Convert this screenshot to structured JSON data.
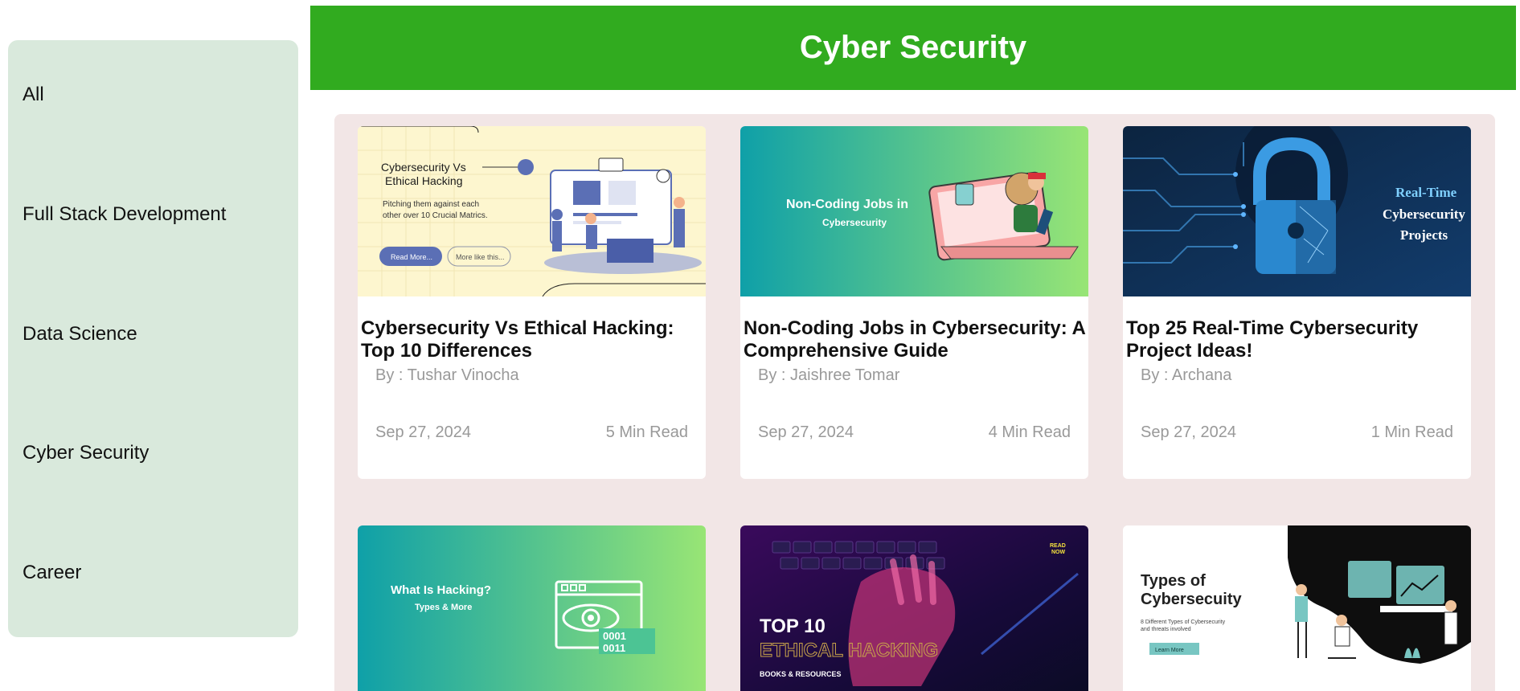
{
  "sidebar": {
    "items": [
      {
        "label": "All"
      },
      {
        "label": "Full Stack Development"
      },
      {
        "label": "Data Science"
      },
      {
        "label": "Cyber Security"
      },
      {
        "label": "Career"
      }
    ]
  },
  "header": {
    "title": "Cyber Security"
  },
  "colors": {
    "header_bg": "#31ab1f",
    "sidebar_bg": "#d9e9dc",
    "panel_bg": "#f2e6e6",
    "muted_text": "#999999"
  },
  "cards": [
    {
      "title": "Cybersecurity Vs Ethical Hacking: Top 10 Differences",
      "author": "By : Tushar Vinocha",
      "date": "Sep 27, 2024",
      "read_time": "5 Min Read",
      "thumb": {
        "heading_line1": "Cybersecurity Vs",
        "heading_line2": "Ethical Hacking",
        "sub_line1": "Pitching them against each",
        "sub_line2": "other over 10 Crucial Matrics.",
        "btn_primary": "Read More...",
        "btn_secondary": "More like this..."
      }
    },
    {
      "title": "Non-Coding Jobs in Cybersecurity: A Comprehensive Guide",
      "author": "By : Jaishree Tomar",
      "date": "Sep 27, 2024",
      "read_time": "4 Min Read",
      "thumb": {
        "line1": "Non-Coding Jobs in",
        "line2": "Cybersecurity"
      }
    },
    {
      "title": "Top 25 Real-Time Cybersecurity Project Ideas!",
      "author": "By : Archana",
      "date": "Sep 27, 2024",
      "read_time": "1 Min Read",
      "thumb": {
        "line1": "Real-Time",
        "line2": "Cybersecurity",
        "line3": "Projects"
      }
    },
    {
      "thumb": {
        "line1": "What Is Hacking?",
        "line2": "Types & More",
        "binary1": "0001",
        "binary2": "0011"
      }
    },
    {
      "thumb": {
        "corner1": "READ",
        "corner2": "NOW",
        "line1": "TOP 10",
        "line2": "ETHICAL HACKING",
        "line3": "BOOKS & RESOURCES"
      }
    },
    {
      "thumb": {
        "line1": "Types of",
        "line2": "Cybersecuity",
        "sub_line1": "8 Different Types of Cybersecurity",
        "sub_line2": "and threats involved",
        "btn": "Learn More"
      }
    }
  ]
}
